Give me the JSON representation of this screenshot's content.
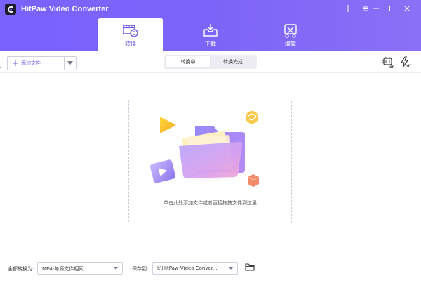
{
  "app": {
    "title": "HitPaw Video Converter",
    "logo_icon": "hitpaw-logo-icon"
  },
  "window_controls": [
    "menu-icon",
    "settings-icon",
    "minimize-icon",
    "maximize-icon",
    "close-icon"
  ],
  "tabs": [
    {
      "label": "转换",
      "icon": "convert-icon",
      "active": true
    },
    {
      "label": "下载",
      "icon": "download-icon",
      "active": false
    },
    {
      "label": "编辑",
      "icon": "edit-icon",
      "active": false
    }
  ],
  "toolbar": {
    "add_file_label": "添加文件",
    "segments": [
      "转换中",
      "转换完成"
    ],
    "right_icons": [
      {
        "name": "hardware-accel-icon",
        "badge": "on"
      },
      {
        "name": "lightning-icon",
        "badge": "off"
      }
    ]
  },
  "drop_zone": {
    "hint": "单击此处添加文件或者直接拖拽文件到这里"
  },
  "footer": {
    "convert_all_label": "全部转换为:",
    "convert_all_value": "MP4-与源文件相同",
    "save_to_label": "保存到:",
    "save_to_value": "I:\\HitPaw Video Conver...",
    "folder_icon": "folder-icon"
  },
  "colors": {
    "accent": "#7a62ff",
    "accent_text": "#6c5ce7"
  }
}
